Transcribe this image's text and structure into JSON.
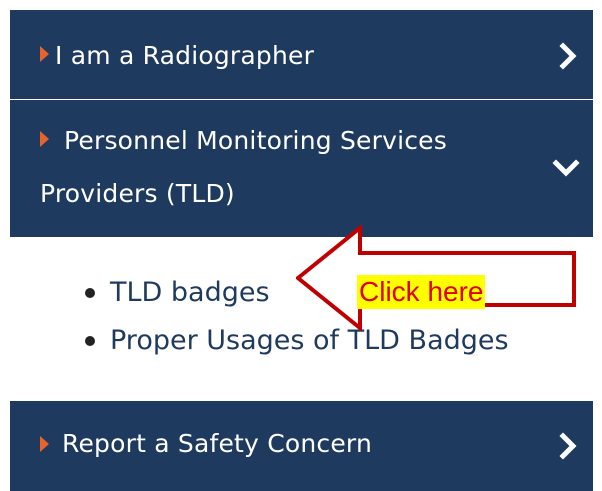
{
  "menu": {
    "items": [
      {
        "label": "I am a Radiographer",
        "expanded": false
      },
      {
        "label_line1": "Personnel Monitoring Services",
        "label_line2": "Providers (TLD)",
        "expanded": true
      },
      {
        "label": "Report a Safety Concern",
        "expanded": false
      }
    ],
    "submenu": [
      {
        "label": "TLD badges"
      },
      {
        "label": "Proper Usages of TLD Badges"
      }
    ]
  },
  "callout": {
    "text": "Click here"
  },
  "icons": {
    "bullet": "orange-triangle-bullet-icon",
    "collapsed": "chevron-right-icon",
    "expanded": "chevron-down-icon"
  },
  "colors": {
    "menu_bg": "#1f3a5f",
    "bullet": "#e8622c",
    "link": "#1f3a5f",
    "callout_border": "#c00000",
    "callout_text": "#e00000",
    "callout_highlight": "#ffff00"
  }
}
